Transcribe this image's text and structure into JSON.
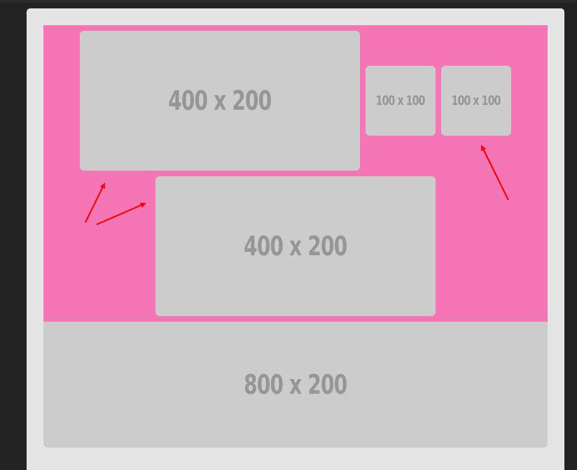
{
  "placeholders": {
    "large_top": "400 x 200",
    "square_left": "100 x 100",
    "square_right": "100 x 100",
    "large_middle": "400 x 200",
    "wide_bottom": "800 x 200"
  },
  "colors": {
    "background": "#232323",
    "panel": "#e5e5e5",
    "highlight": "#f476b6",
    "placeholder_fill": "#cccccc",
    "placeholder_text": "#969696",
    "annotation_arrow": "#ff0000"
  }
}
